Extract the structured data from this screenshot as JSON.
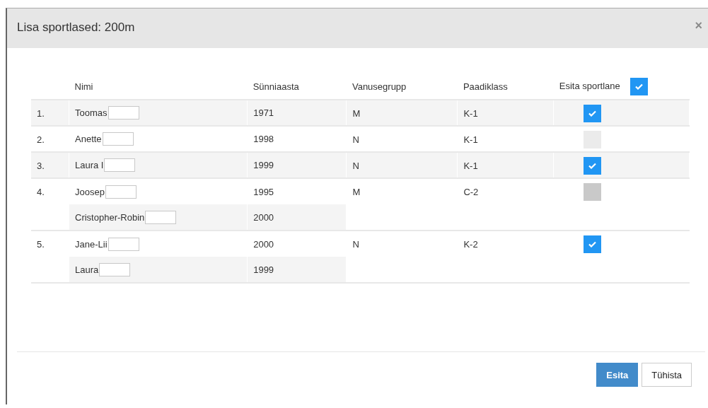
{
  "dialog": {
    "title": "Lisa sportlased: 200m",
    "close": "×"
  },
  "table": {
    "columns": [
      "Nimi",
      "Sünniaasta",
      "Vanusegrupp",
      "Paadiklass",
      "Esita sportlane"
    ],
    "select_all": {
      "checked": true
    },
    "rows": [
      {
        "number": "1.",
        "members": [
          {
            "name": "Toomas",
            "year": "1971"
          }
        ],
        "age_group": "M",
        "boat_class": "K-1",
        "checked": true,
        "disabled": false
      },
      {
        "number": "2.",
        "members": [
          {
            "name": "Anette",
            "year": "1998"
          }
        ],
        "age_group": "N",
        "boat_class": "K-1",
        "checked": false,
        "disabled": false
      },
      {
        "number": "3.",
        "members": [
          {
            "name": "Laura I",
            "year": "1999"
          }
        ],
        "age_group": "N",
        "boat_class": "K-1",
        "checked": true,
        "disabled": false
      },
      {
        "number": "4.",
        "members": [
          {
            "name": "Joosep",
            "year": "1995"
          },
          {
            "name": "Cristopher-Robin",
            "year": "2000"
          }
        ],
        "age_group": "M",
        "boat_class": "C-2",
        "checked": false,
        "disabled": true
      },
      {
        "number": "5.",
        "members": [
          {
            "name": "Jane-Lii",
            "year": "2000"
          },
          {
            "name": "Laura",
            "year": "1999"
          }
        ],
        "age_group": "N",
        "boat_class": "K-2",
        "checked": true,
        "disabled": false
      }
    ]
  },
  "buttons": [
    {
      "label": "Esita",
      "kind": "primary"
    },
    {
      "label": "Tühista",
      "kind": "default"
    }
  ]
}
